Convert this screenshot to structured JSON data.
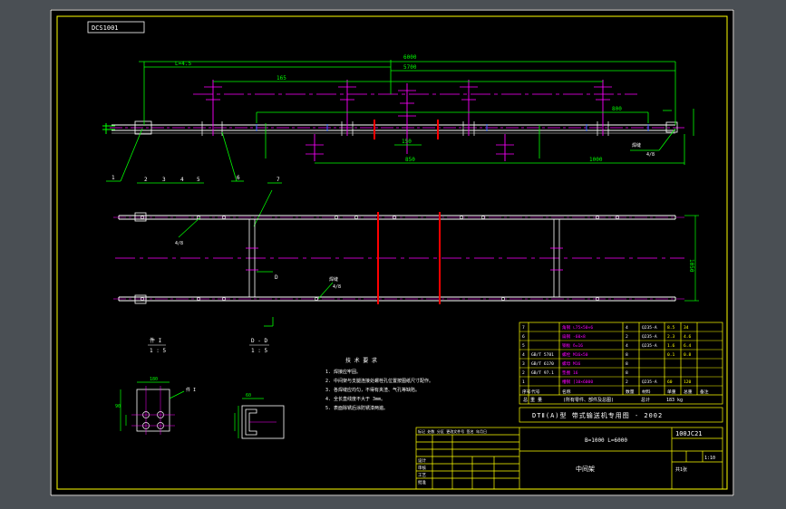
{
  "drawing": {
    "code_box": "DCS1001",
    "view_a_label": "件 I",
    "view_a_scale": "1 : 5",
    "view_b_label": "D - D",
    "view_b_scale": "1 : 5",
    "view_a_callout": "件 I",
    "view_b_callout": "D",
    "notes_title": "技 术 要 求",
    "notes": [
      "1. 焊接应牢固。",
      "2. 中间架与支腿连接处螺栓孔位置按图纸尺寸配作。",
      "3. 各焊缝应均匀，不得有夹渣、气孔等缺陷。",
      "4. 全长直线度不大于 3mm。",
      "5. 表面除锈后涂防锈漆两遍。"
    ],
    "dim_labels": {
      "a": "6000",
      "b": "5700",
      "c": "L=4.5",
      "d": "165",
      "e": "800",
      "f": "1000",
      "g": "850",
      "h": "150",
      "k": "1050",
      "p": "180",
      "q": "90",
      "r": "60"
    },
    "balloons": [
      "1",
      "2",
      "3",
      "4",
      "5",
      "6",
      "7"
    ],
    "weld_labels": [
      "焊缝",
      "焊缝"
    ],
    "weld_sizes": [
      "4/8",
      "4/8",
      "4/8"
    ]
  },
  "parts_table": {
    "rows": [
      [
        "7",
        "",
        "角钢 ∟75×50×6",
        "4",
        "Q235-A",
        "8.5",
        "34"
      ],
      [
        "6",
        "",
        "扁钢 -60×8",
        "2",
        "Q235-A",
        "2.3",
        "4.6"
      ],
      [
        "5",
        "",
        "钢板 δ=16",
        "4",
        "Q235-A",
        "1.6",
        "6.4"
      ],
      [
        "4",
        "GB/T 5781",
        "螺栓 M16×50",
        "8",
        "",
        "0.1",
        "0.8"
      ],
      [
        "3",
        "GB/T 6170",
        "螺母 M16",
        "8",
        "",
        "",
        ""
      ],
      [
        "2",
        "GB/T 97.1",
        "垫圈 16",
        "8",
        "",
        "",
        ""
      ],
      [
        "1",
        "",
        "槽钢 [10×6000",
        "2",
        "Q235-A",
        "60",
        "120"
      ]
    ],
    "header": [
      "序号",
      "代号",
      "名称",
      "数量",
      "材料",
      "单重",
      "总重",
      "备注"
    ],
    "footer": [
      "总 重 量",
      "(所有零件、部件及总图)",
      "总计",
      "183 kg"
    ]
  },
  "title_block": {
    "series": "DTⅡ(A)型 带式输送机专用图 - 2002",
    "spec": "B=1000 L=6000",
    "name": "中间架",
    "drawing_no": "100JC21",
    "scale_label": "1:10",
    "sheet_label": "共1张",
    "revision_header": "标记  处数  分区  更改文件号  签名  年月日",
    "revision_rows": [
      "设计",
      "审核",
      "工艺",
      "批准"
    ]
  },
  "colors": {
    "sheet": "#000000",
    "frame": "#ffffff",
    "yellow": "#ffff00",
    "green": "#00ff00",
    "magenta": "#ff00ff",
    "red": "#ff0000",
    "white": "#ffffff"
  }
}
